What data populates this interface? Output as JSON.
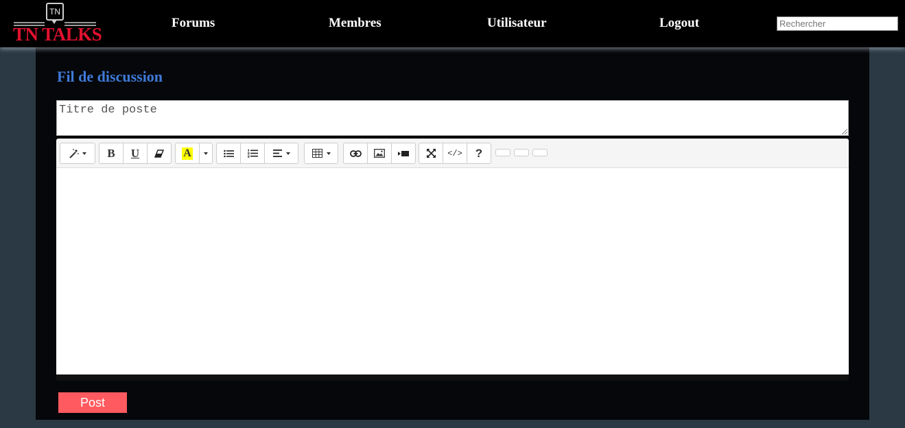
{
  "header": {
    "logo_badge": "TN",
    "logo_text": "TN TALKS",
    "nav": [
      {
        "label": "Forums"
      },
      {
        "label": "Membres"
      },
      {
        "label": "Utilisateur"
      },
      {
        "label": "Logout"
      }
    ],
    "search_placeholder": "Rechercher"
  },
  "main": {
    "title": "Fil de discussion",
    "title_input_placeholder": "Titre de poste",
    "editor": {
      "toolbar": {
        "bold": "B",
        "underline": "U",
        "help": "?",
        "code_view": "</>",
        "highlight": "A"
      }
    },
    "post_button": "Post"
  },
  "colors": {
    "navbar_bg": "#000000",
    "page_bg": "#2a3944",
    "panel_bg": "#05070a",
    "title_blue": "#3f7ad8",
    "logo_red": "#e0112f",
    "post_button_bg": "#ff5a5f",
    "highlight_yellow": "#ffff00"
  }
}
